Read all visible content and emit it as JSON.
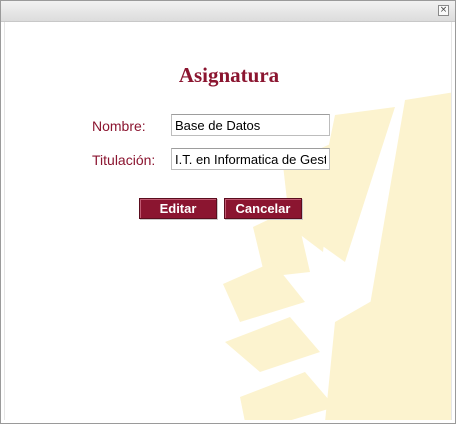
{
  "window": {
    "close_glyph": "×"
  },
  "form": {
    "title": "Asignatura",
    "nombre": {
      "label": "Nombre:",
      "value": "Base de Datos"
    },
    "titulacion": {
      "label": "Titulación:",
      "value": "I.T. en Informatica de Gestión"
    },
    "buttons": {
      "edit_label": "Editar",
      "cancel_label": "Cancelar"
    }
  },
  "colors": {
    "accent": "#8b1530",
    "watermark": "#fcf3cf"
  }
}
